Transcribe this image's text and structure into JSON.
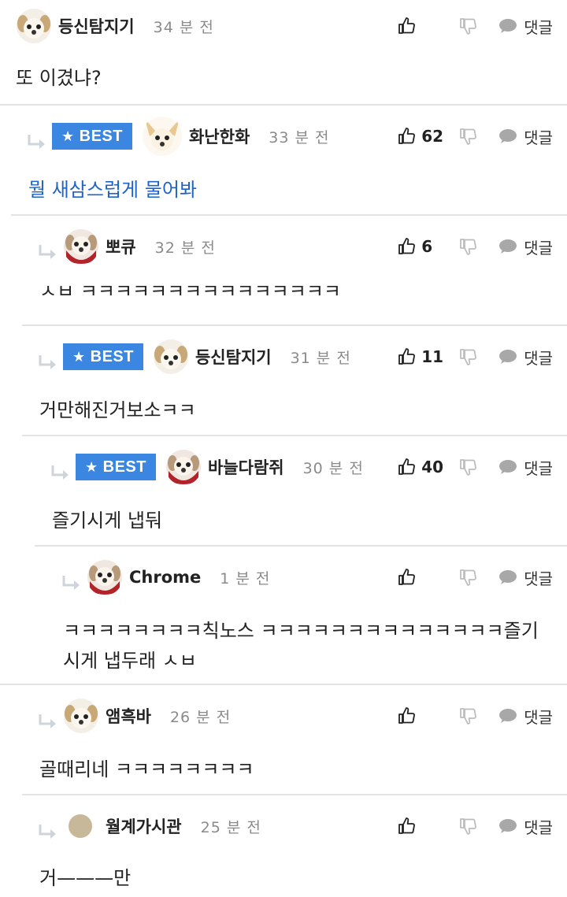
{
  "comments": [
    {
      "nick": "등신탐지기",
      "time": "34 분 전",
      "text": "또 이겼냐?",
      "likes": "",
      "best": false,
      "reply_label": "댓글"
    },
    {
      "nick": "화난한화",
      "time": "33 분 전",
      "text": "뭘 새삼스럽게 물어봐",
      "likes": "62",
      "best": true,
      "reply_label": "댓글"
    },
    {
      "nick": "뽀큐",
      "time": "32 분 전",
      "text": "ㅅㅂ ㅋㅋㅋㅋㅋㅋㅋㅋㅋㅋㅋㅋㅋㅋㅋ",
      "likes": "6",
      "best": false,
      "reply_label": "댓글"
    },
    {
      "nick": "등신탐지기",
      "time": "31 분 전",
      "text": "거만해진거보소ㅋㅋ",
      "likes": "11",
      "best": true,
      "reply_label": "댓글"
    },
    {
      "nick": "바늘다람쥐",
      "time": "30 분 전",
      "text": "즐기시게 냅둬",
      "likes": "40",
      "best": true,
      "reply_label": "댓글"
    },
    {
      "nick": "Chrome",
      "time": "1 분 전",
      "text_line1": "ㅋㅋㅋㅋㅋㅋㅋㅋ칙노스 ㅋㅋㅋㅋㅋㅋㅋㅋㅋㅋㅋㅋㅋㅋ즐기",
      "text_line2": "시게 냅두래 ㅅㅂ",
      "likes": "",
      "best": false,
      "reply_label": "댓글"
    },
    {
      "nick": "앰흑바",
      "time": "26 분 전",
      "text": "골때리네 ㅋㅋㅋㅋㅋㅋㅋㅋ",
      "likes": "",
      "best": false,
      "reply_label": "댓글"
    },
    {
      "nick": "월계가시관",
      "time": "25 분 전",
      "text": "거———만",
      "likes": "",
      "best": false,
      "reply_label": "댓글"
    }
  ],
  "best_label": "BEST",
  "colors": {
    "best_badge": "#3b86e0",
    "best_text": "#1e64c8",
    "divider": "#e3e3e3",
    "icon": "#9a9a9a"
  }
}
